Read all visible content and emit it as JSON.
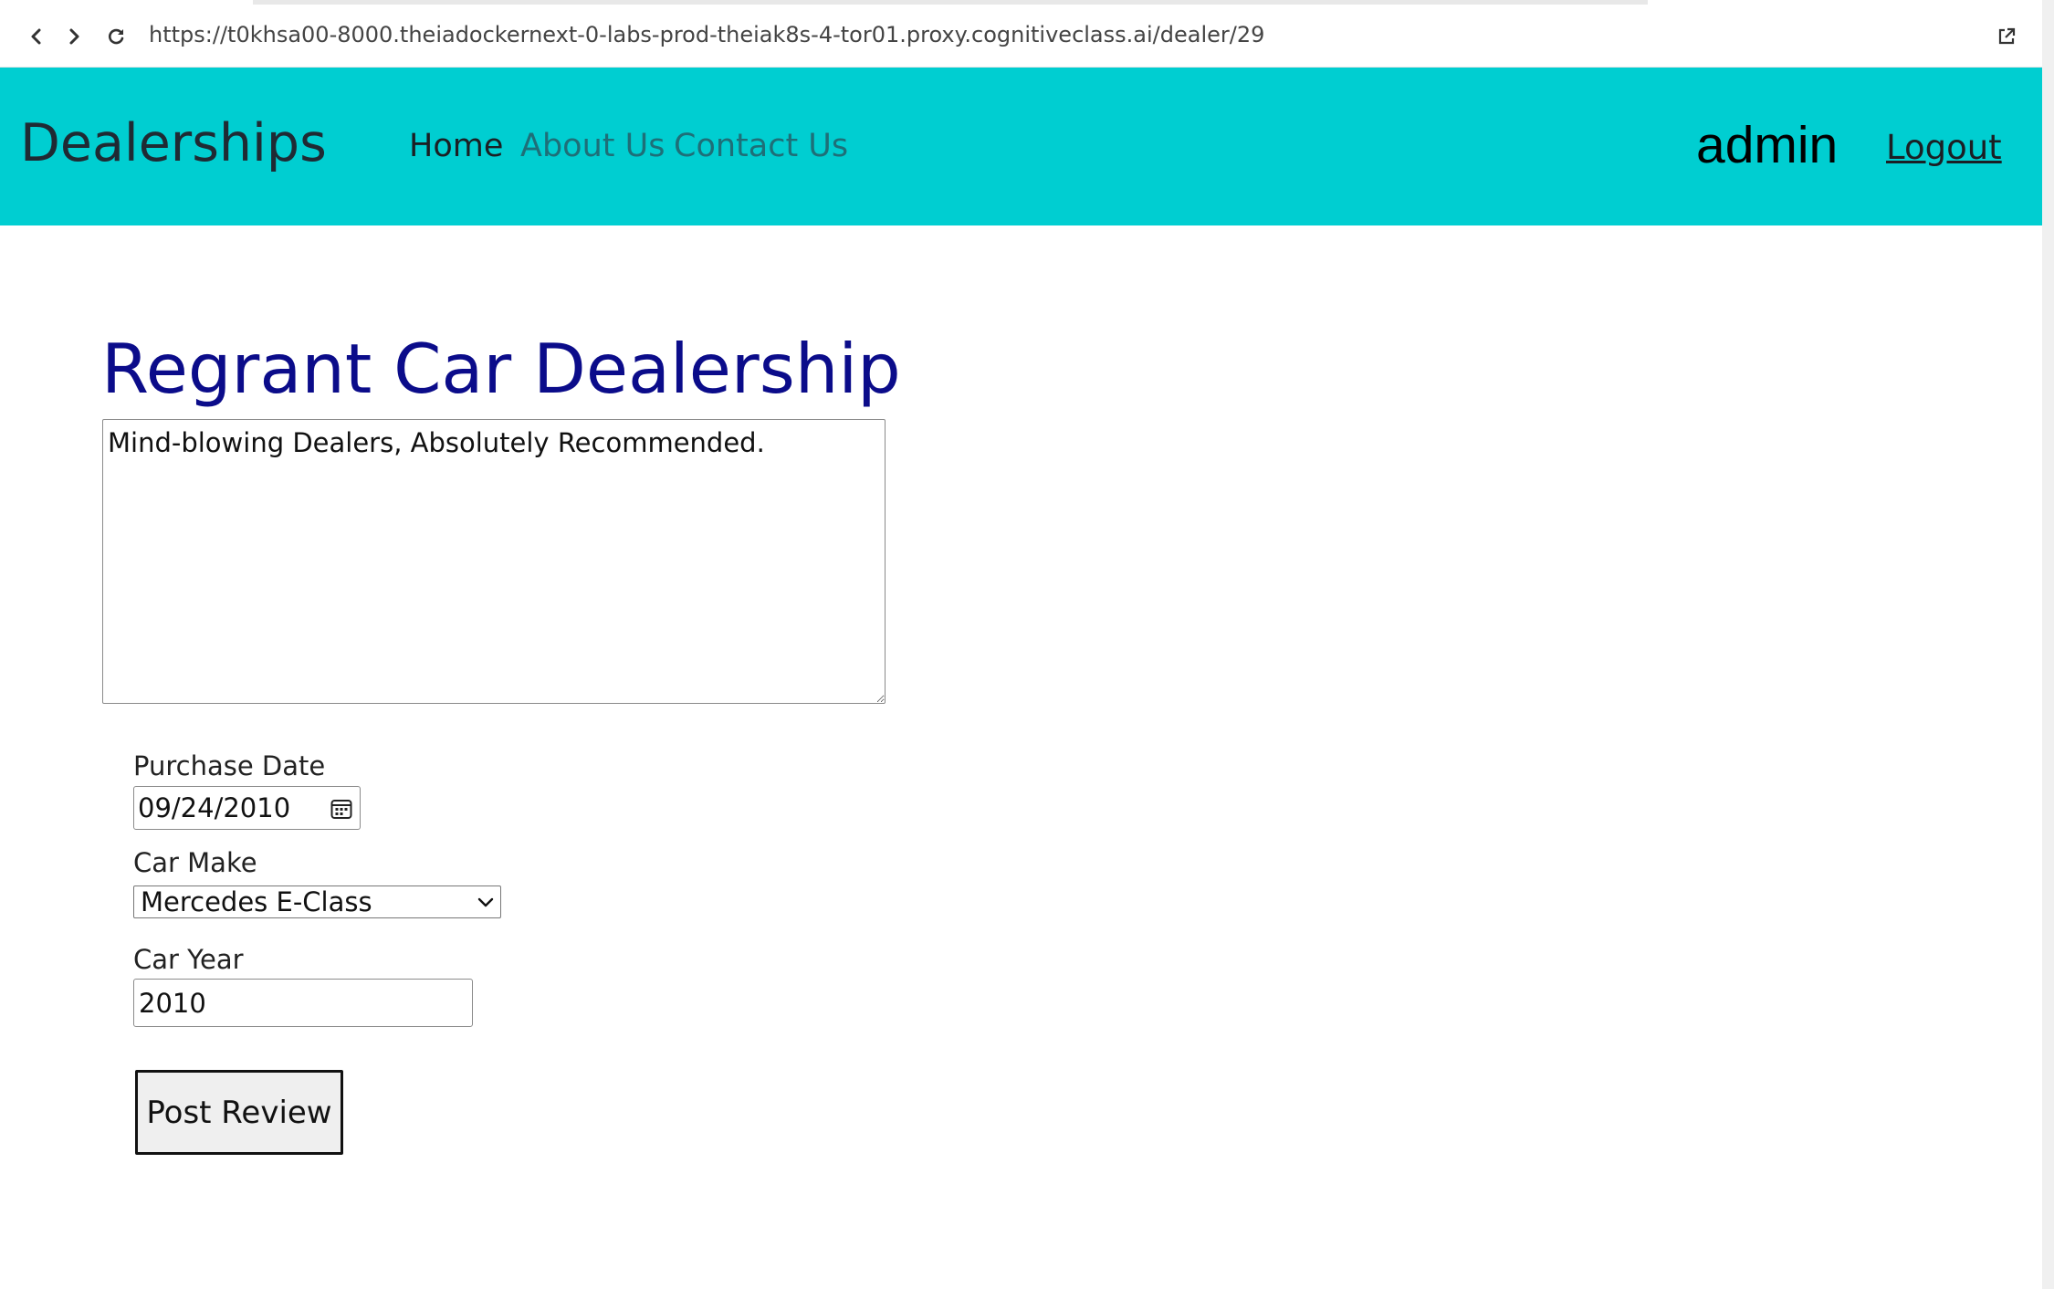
{
  "browser": {
    "url": "https://t0khsa00-8000.theiadockernext-0-labs-prod-theiak8s-4-tor01.proxy.cognitiveclass.ai/dealer/29",
    "back_icon": "chevron-left-icon",
    "forward_icon": "chevron-right-icon",
    "reload_icon": "reload-icon",
    "external_icon": "external-link-icon"
  },
  "navbar": {
    "brand": "Dealerships",
    "links": [
      {
        "label": "Home"
      },
      {
        "label": "About Us"
      },
      {
        "label": "Contact Us"
      }
    ],
    "username": "admin",
    "logout_label": "Logout",
    "background_color": "#00ced1"
  },
  "main": {
    "dealer_name": "Regrant Car Dealership",
    "title_color": "#0b0c8a",
    "review_text": "Mind-blowing Dealers, Absolutely Recommended.",
    "purchase_date_label": "Purchase Date",
    "purchase_date_value": "09/24/2010",
    "car_make_label": "Car Make",
    "car_make_value": "Mercedes E-Class",
    "car_year_label": "Car Year",
    "car_year_value": "2010",
    "post_button_label": "Post Review"
  }
}
